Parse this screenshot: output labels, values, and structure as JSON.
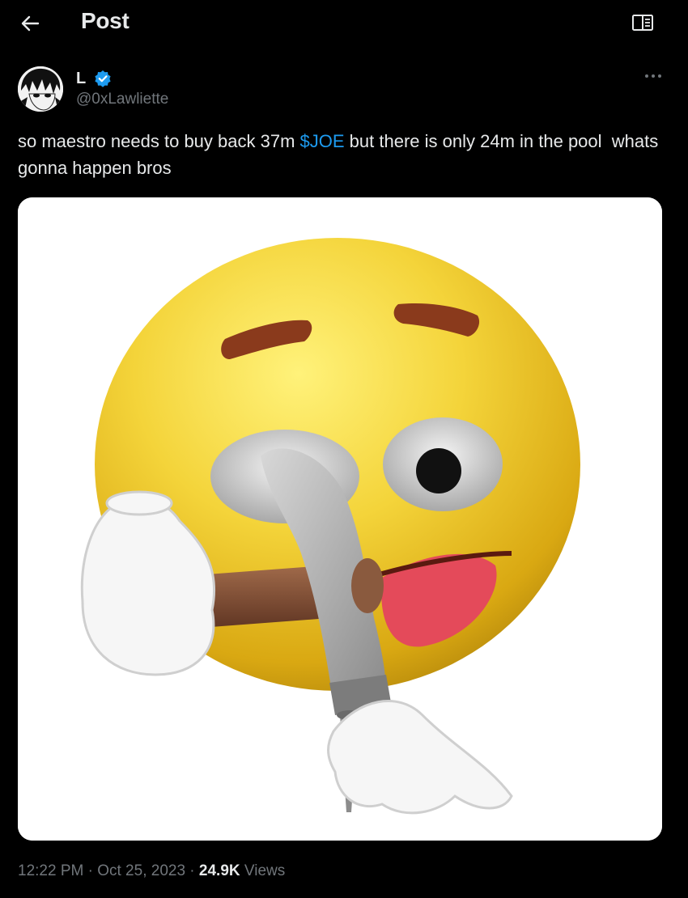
{
  "header": {
    "title": "Post",
    "back_icon": "arrow-left-icon",
    "reader_icon": "open-book-icon"
  },
  "author": {
    "display_name": "L",
    "handle": "@0xLawliette",
    "verified": true,
    "verified_color": "#1d9bf0"
  },
  "post": {
    "text_before": "so maestro needs to buy back 37m ",
    "cashtag": "$JOE",
    "text_after": " but there is only 24m in the pool  whats gonna happen bros",
    "media_description_icon": "emoji-hammer-image"
  },
  "meta": {
    "time": "12:22 PM",
    "sep1": " · ",
    "date": "Oct 25, 2023",
    "sep2": " · ",
    "views_count": "24.9K",
    "views_label": " Views"
  },
  "colors": {
    "background": "#000000",
    "text": "#e7e9ea",
    "secondary": "#71767b",
    "accent": "#1d9bf0"
  }
}
